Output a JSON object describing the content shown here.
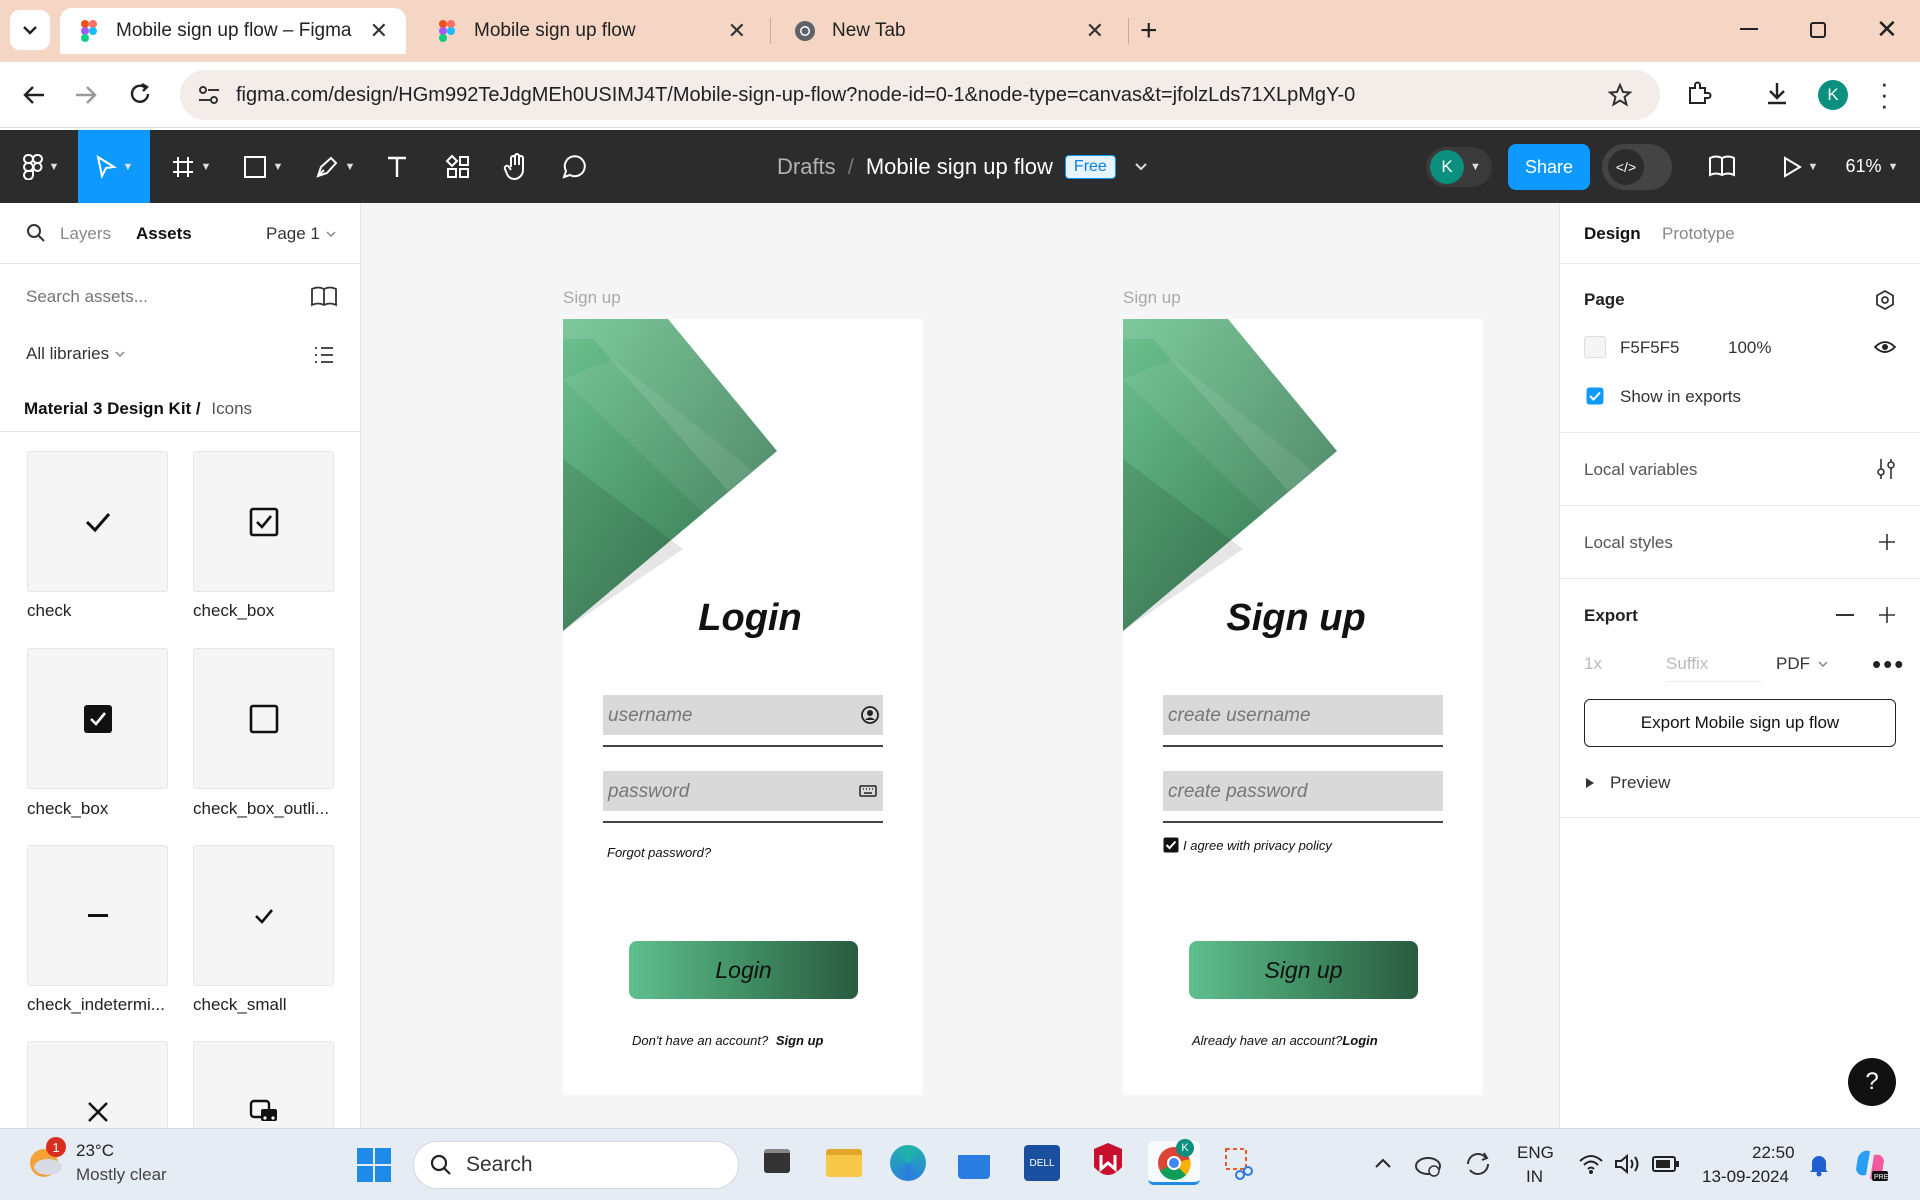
{
  "browser": {
    "tabs": [
      {
        "title": "Mobile sign up flow – Figma",
        "active": true
      },
      {
        "title": "Mobile sign up flow",
        "active": false
      },
      {
        "title": "New Tab",
        "active": false
      }
    ],
    "url": "figma.com/design/HGm992TeJdgMEh0USIMJ4T/Mobile-sign-up-flow?node-id=0-1&node-type=canvas&t=jfolzLds71XLpMgY-0",
    "profile_initial": "K"
  },
  "toolbar": {
    "breadcrumb_root": "Drafts",
    "separator": "/",
    "file_name": "Mobile sign up flow",
    "plan_badge": "Free",
    "avatar_initial": "K",
    "share_label": "Share",
    "zoom": "61%"
  },
  "left_panel": {
    "tab_layers": "Layers",
    "tab_assets": "Assets",
    "page_selector": "Page 1",
    "search_placeholder": "Search assets...",
    "libraries": "All libraries",
    "breadcrumb_library": "Material 3 Design Kit /",
    "breadcrumb_folder": "Icons",
    "assets": [
      {
        "label": "check",
        "icon": "check-icon"
      },
      {
        "label": "check_box",
        "icon": "check-box-icon"
      },
      {
        "label": "check_box",
        "icon": "check-box-filled-icon"
      },
      {
        "label": "check_box_outli...",
        "icon": "check-box-outline-icon"
      },
      {
        "label": "check_indetermi...",
        "icon": "check-indeterminate-icon"
      },
      {
        "label": "check_small",
        "icon": "check-small-icon"
      },
      {
        "label": "",
        "icon": "close-icon"
      },
      {
        "label": "",
        "icon": "commute-icon"
      }
    ]
  },
  "canvas": {
    "login": {
      "frame_label": "Sign up",
      "title": "Login",
      "username_placeholder": "username",
      "password_placeholder": "password",
      "forgot": "Forgot password?",
      "button": "Login",
      "footer_text": "Don't have an account?",
      "footer_link": "Sign up"
    },
    "signup": {
      "frame_label": "Sign up",
      "title": "Sign up",
      "username_placeholder": "create username",
      "password_placeholder": "create password",
      "agree": "I agree with privacy policy",
      "agree_checked": true,
      "button": "Sign up",
      "footer_text": "Already have an account?",
      "footer_link": "Login"
    }
  },
  "right_panel": {
    "tab_design": "Design",
    "tab_prototype": "Prototype",
    "page_heading": "Page",
    "page_color": "F5F5F5",
    "page_opacity": "100%",
    "show_in_exports": "Show in exports",
    "show_in_exports_checked": true,
    "local_variables": "Local variables",
    "local_styles": "Local styles",
    "export_heading": "Export",
    "export_scale": "1x",
    "export_suffix_placeholder": "Suffix",
    "export_format": "PDF",
    "export_button": "Export Mobile sign up flow",
    "preview": "Preview",
    "help": "?"
  },
  "taskbar": {
    "weather_temp": "23°C",
    "weather_desc": "Mostly clear",
    "weather_badge": "1",
    "search_label": "Search",
    "lang_line1": "ENG",
    "lang_line2": "IN",
    "time": "22:50",
    "date": "13-09-2024"
  },
  "colors": {
    "figma_blue": "#0d99ff",
    "toolbar_bg": "#2c2c2c",
    "tabbar_bg": "#f5d6c5",
    "canvas_bg": "#f5f5f5",
    "green_dark": "#2a5a40",
    "green_light": "#5fbf8e"
  }
}
